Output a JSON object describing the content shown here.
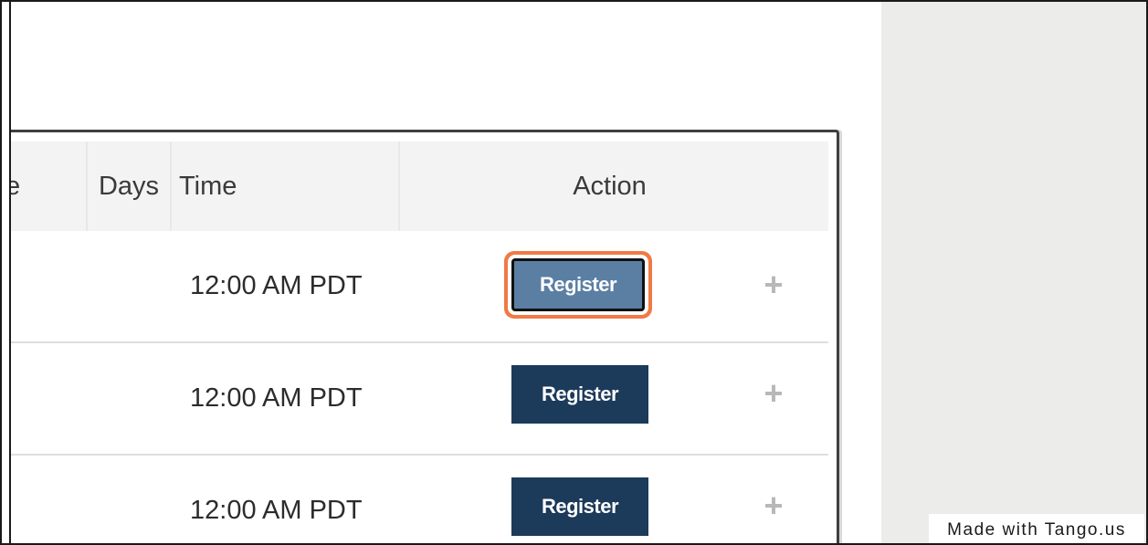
{
  "table": {
    "headers": {
      "prev_partial": "e",
      "days": "Days",
      "time": "Time",
      "action": "Action"
    },
    "rows": [
      {
        "time": "12:00 AM PDT",
        "button": "Register",
        "expand": "+"
      },
      {
        "time": "12:00 AM PDT",
        "button": "Register",
        "expand": "+"
      },
      {
        "time": "12:00 AM PDT",
        "button": "Register",
        "expand": "+"
      }
    ]
  },
  "watermark": "Made with Tango.us",
  "colors": {
    "button_primary": "#1c3a5a",
    "button_hover": "#5b7fa3",
    "highlight_ring": "#f07a45",
    "side_panel": "#ececea"
  }
}
